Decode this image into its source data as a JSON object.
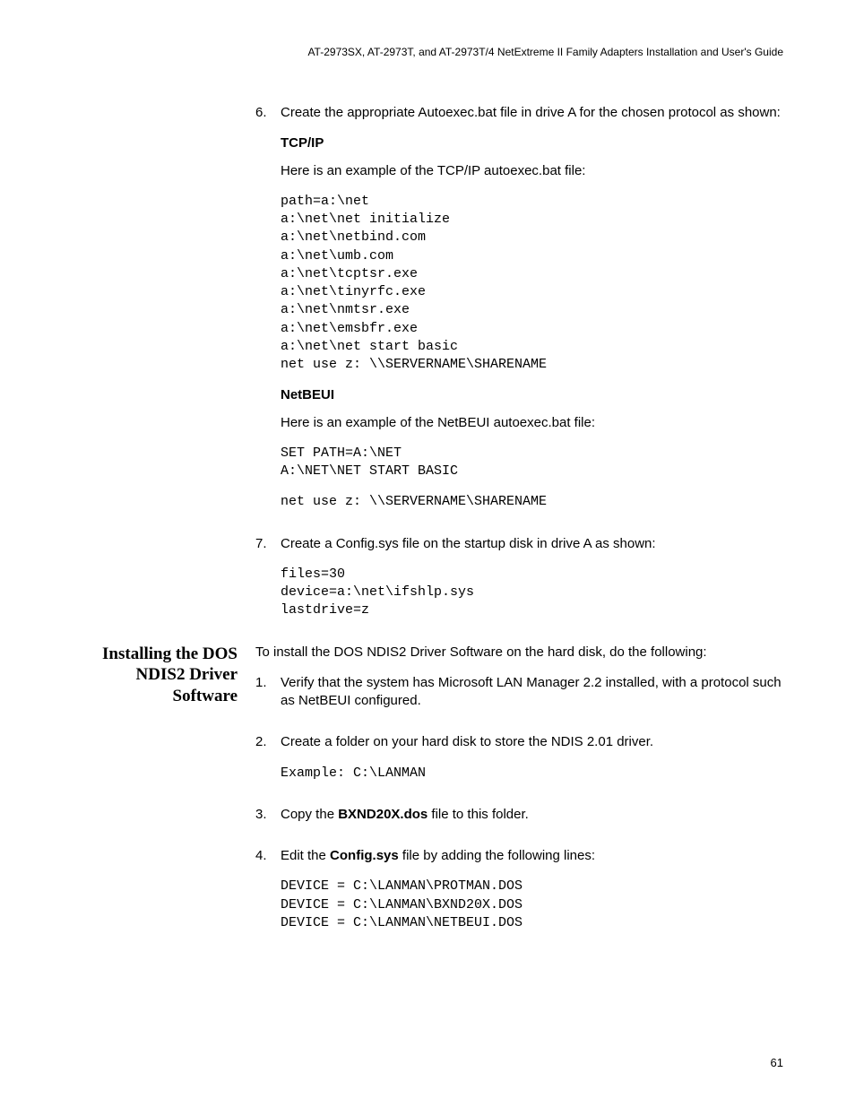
{
  "header": {
    "running": "AT-2973SX, AT-2973T, and AT-2973T/4 NetExtreme II Family Adapters Installation and User's Guide"
  },
  "footer": {
    "page_number": "61"
  },
  "section1": {
    "step6": {
      "num": "6.",
      "text": "Create the appropriate Autoexec.bat file in drive A for the chosen protocol as shown:",
      "tcp": {
        "heading": "TCP/IP",
        "intro": "Here is an example of the TCP/IP autoexec.bat file:",
        "code": "path=a:\\net\na:\\net\\net initialize\na:\\net\\netbind.com\na:\\net\\umb.com\na:\\net\\tcptsr.exe\na:\\net\\tinyrfc.exe\na:\\net\\nmtsr.exe\na:\\net\\emsbfr.exe\na:\\net\\net start basic\nnet use z: \\\\SERVERNAME\\SHARENAME"
      },
      "netbeui": {
        "heading": "NetBEUI",
        "intro": "Here is an example of the NetBEUI autoexec.bat file:",
        "code1": "SET PATH=A:\\NET\nA:\\NET\\NET START BASIC",
        "code2": "net use z: \\\\SERVERNAME\\SHARENAME"
      }
    },
    "step7": {
      "num": "7.",
      "text": "Create a Config.sys file on the startup disk in drive A as shown:",
      "code": "files=30\ndevice=a:\\net\\ifshlp.sys\nlastdrive=z"
    }
  },
  "section2": {
    "heading": "Installing the DOS NDIS2 Driver Software",
    "intro": "To install the DOS NDIS2 Driver Software on the hard disk, do the following:",
    "step1": {
      "num": "1.",
      "text": "Verify that the system has Microsoft LAN Manager 2.2 installed, with a protocol such as NetBEUI configured."
    },
    "step2": {
      "num": "2.",
      "text": "Create a folder on your hard disk to store the NDIS 2.01 driver.",
      "code": "Example: C:\\LANMAN"
    },
    "step3": {
      "num": "3.",
      "pre": "Copy the ",
      "bold": "BXND20X.dos",
      "post": " file to this folder."
    },
    "step4": {
      "num": "4.",
      "pre": "Edit the ",
      "bold": "Config.sys",
      "post": " file by adding the following lines:",
      "code": "DEVICE = C:\\LANMAN\\PROTMAN.DOS\nDEVICE = C:\\LANMAN\\BXND20X.DOS\nDEVICE = C:\\LANMAN\\NETBEUI.DOS"
    }
  }
}
